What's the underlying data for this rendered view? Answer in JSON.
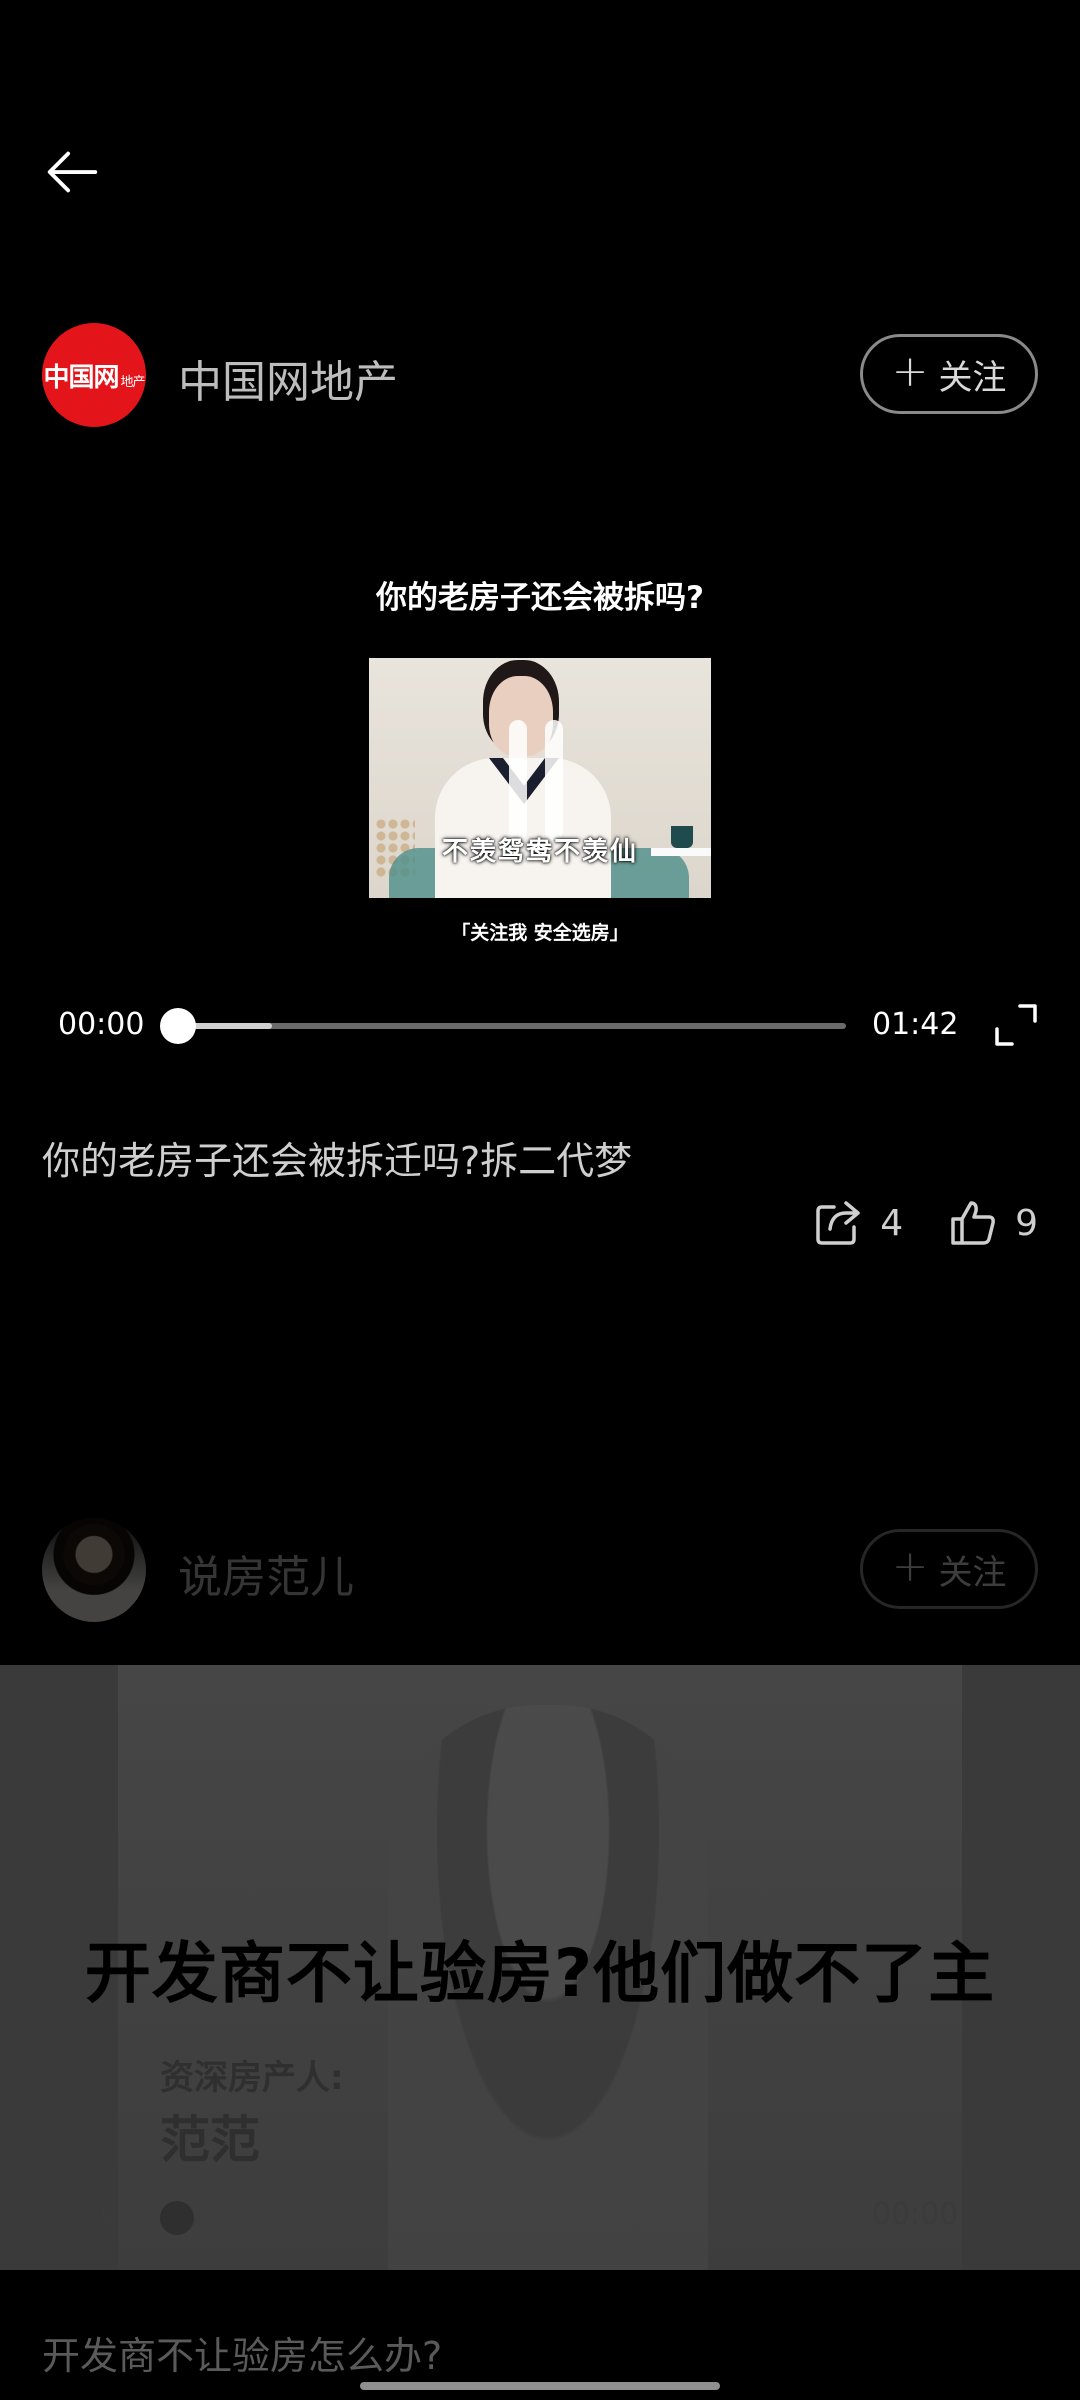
{
  "nav": {
    "back_icon": "arrow-left-icon"
  },
  "post1": {
    "author": "中国网地产",
    "avatar_logo": "中国网",
    "avatar_logo_small": "地产",
    "follow_label": "关注",
    "video_title": "你的老房子还会被拆吗?",
    "video_caption": "不羡鸳鸯不羡仙",
    "video_sub": "「关注我  安全选房」",
    "time_current": "00:00",
    "time_total": "01:42",
    "played_fraction": 0,
    "buffered_fraction": 0.14,
    "description": "你的老房子还会被拆迁吗?拆二代梦",
    "share_count": "4",
    "like_count": "9"
  },
  "post2": {
    "author": "说房范儿",
    "follow_label": "关注",
    "headline": "开发商不让验房?他们做不了主",
    "label1": "资深房产人:",
    "label2": "范范",
    "time_left": "0",
    "time_right": "00:00",
    "description": "开发商不让验房怎么办?"
  },
  "colors": {
    "accent_red": "#e3151b",
    "background": "#000000"
  }
}
